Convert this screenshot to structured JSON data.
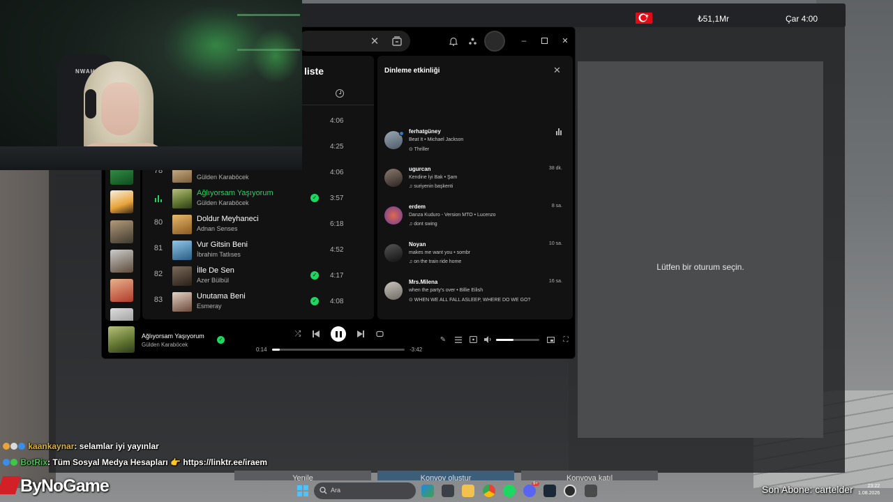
{
  "game": {
    "money": "₺51,1Mr",
    "clock": "Çar 4:00",
    "session_message": "Lütfen bir oturum seçin.",
    "buttons": [
      "Yenile",
      "Konvoy oluştur",
      "Konvoya katıl"
    ]
  },
  "webcam": {
    "chair_brand": "NWAH"
  },
  "spotify": {
    "playlist_title_partial": "liste",
    "tracks": [
      {
        "num": "",
        "name": "",
        "artist": "",
        "duration": "4:06",
        "saved": false,
        "playing": false
      },
      {
        "num": "",
        "name": "",
        "artist": "",
        "duration": "4:25",
        "saved": false,
        "playing": false
      },
      {
        "num": "78",
        "name": "",
        "artist": "Gülden Karaböcek",
        "duration": "4:06",
        "saved": false,
        "playing": false
      },
      {
        "num": "",
        "name": "Ağlıyorsam Yaşıyorum",
        "artist": "Gülden Karaböcek",
        "duration": "3:57",
        "saved": true,
        "playing": true
      },
      {
        "num": "80",
        "name": "Doldur Meyhaneci",
        "artist": "Adnan Senses",
        "duration": "6:18",
        "saved": false,
        "playing": false
      },
      {
        "num": "81",
        "name": "Vur Gitsin Beni",
        "artist": "İbrahim Tatlıses",
        "duration": "4:52",
        "saved": false,
        "playing": false
      },
      {
        "num": "82",
        "name": "İlle De Sen",
        "artist": "Azer Bülbül",
        "duration": "4:17",
        "saved": true,
        "playing": false
      },
      {
        "num": "83",
        "name": "Unutama Beni",
        "artist": "Esmeray",
        "duration": "4:08",
        "saved": true,
        "playing": false
      }
    ],
    "friend_activity": {
      "title": "Dinleme etkinliği",
      "friends": [
        {
          "name": "ferhatgüney",
          "song": "Beat It • Michael Jackson",
          "context": "⊙ Thriller",
          "time": "",
          "live": true
        },
        {
          "name": "ugurcan",
          "song": "Kendine İyi Bak • Şam",
          "context": "♫ suriyenin başkenti",
          "time": "38 dk.",
          "live": false
        },
        {
          "name": "erdem",
          "song": "Danza Kuduro - Version MTO • Lucenzo",
          "context": "♫ dont swing",
          "time": "8 sa.",
          "live": false
        },
        {
          "name": "Noyan",
          "song": "makes me want you • sombr",
          "context": "♫ on the train ride home",
          "time": "10 sa.",
          "live": false
        },
        {
          "name": "Mrs.Milena",
          "song": "when the party's over • Billie Eilish",
          "context": "⊙ WHEN WE ALL FALL ASLEEP, WHERE DO WE GO?",
          "time": "16 sa.",
          "live": false
        }
      ]
    },
    "now_playing": {
      "title": "Ağlıyorsam Yaşıyorum",
      "artist": "Gülden Karaböcek",
      "elapsed": "0:14",
      "remaining": "-3:42",
      "progress_fraction": 0.06,
      "volume_fraction": 0.4
    }
  },
  "chat": [
    {
      "user": "kaankaynar",
      "message": "selamlar iyi yayınlar"
    },
    {
      "user": "BotRix",
      "message": "Tüm Sosyal Medya Hesapları 👉 https://linktr.ee/iraem"
    }
  ],
  "overlay": {
    "brand": "ByNoGame",
    "last_subscriber": "Son Abone: cartelder"
  },
  "taskbar": {
    "search_placeholder": "Ara",
    "time": "23:22",
    "date": "1.08.2026",
    "discord_badge": "9+"
  },
  "colors": {
    "spotify_green": "#1ed760",
    "brand_red": "#d31f26",
    "windows_blue": "#4cc2ff"
  }
}
